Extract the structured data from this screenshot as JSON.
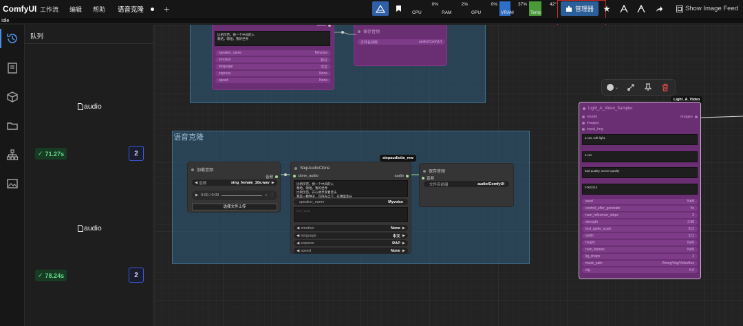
{
  "app": {
    "title": "ComfyUI",
    "status": "Idle"
  },
  "menu": [
    "工作流",
    "编辑",
    "帮助"
  ],
  "tab": {
    "label": "语音克隆"
  },
  "monitor": [
    {
      "label": "CPU",
      "pct": "0%"
    },
    {
      "label": "RAM",
      "pct": "2%"
    },
    {
      "label": "GPU",
      "pct": "0%"
    },
    {
      "label": "VRAM",
      "pct": "37%"
    },
    {
      "label": "Temp",
      "pct": "42°"
    }
  ],
  "toolbar": {
    "manager_label": "管理器",
    "feed_label": "Show Image Feed"
  },
  "queue": {
    "title": "队列",
    "items": [
      {
        "file": "audio",
        "time": "71.27s",
        "count": "2"
      },
      {
        "file": "audio",
        "time": "78.24s",
        "count": "2"
      }
    ]
  },
  "canvas": {
    "group_title": "语音克隆",
    "load_node": {
      "title": "加载音频",
      "out_label": "音频",
      "audio_label": "音频",
      "audio_value": "sing_female_10s.wav",
      "time": "0:00 / 0:00",
      "upload_label": "选择文件上传"
    },
    "clone_node": {
      "title": "StepAudioClone",
      "in_label": "clone_audio",
      "out_label": "audio",
      "text_lines": [
        "比例示范，换一个中间的入",
        "嗯哈，嗯哈，我的世界",
        "比例示范，开心地享受着音乐",
        "我是一颗种子，在阳光之下，在嘴里生长"
      ],
      "speaker_label": "speaker_name",
      "speaker_value": "Myvoice",
      "prompt_placeholder": "text_input",
      "widgets": [
        {
          "label": "emotion",
          "value": "None"
        },
        {
          "label": "language",
          "value": "中文"
        },
        {
          "label": "express",
          "value": "RAP"
        },
        {
          "label": "speed",
          "value": "None"
        }
      ],
      "badge": "stepaudiotts_mw"
    },
    "save_node": {
      "title": "保存音频",
      "in_label": "音频",
      "prefix_label": "文件名前缀",
      "prefix_value": "audio/ComfyUI"
    },
    "top_purple": {
      "text_lines": [
        "比例示范，换一个中间的入",
        "嗯哈，嗯哈，我的世界"
      ],
      "audio_out": "audio",
      "save_prefix_label": "文件名前缀",
      "save_prefix_value": "audio/ComfyUI",
      "widgets": [
        {
          "label": "speaker_name",
          "value": "Myvoice"
        },
        {
          "label": "emotion",
          "value": "默认"
        },
        {
          "label": "language",
          "value": "中文"
        },
        {
          "label": "express",
          "value": "None"
        },
        {
          "label": "speed",
          "value": "None"
        }
      ],
      "save_title": "保存音频"
    },
    "video_node": {
      "badge": "Light_A_Video",
      "title": "Light_A_Video_Sampler",
      "inputs": [
        "model",
        "images",
        "input_img"
      ],
      "out_label": "images",
      "prompts": [
        "a cat, soft light,",
        "a cat",
        "bad quality, worse quality",
        "FIXED1h"
      ],
      "widgets": [
        {
          "label": "seed",
          "value": "NaN"
        },
        {
          "label": "control_after_generate",
          "value": "fix"
        },
        {
          "label": "num_inference_steps",
          "value": "2"
        },
        {
          "label": "strength",
          "value": "2.98"
        },
        {
          "label": "text_guide_scale",
          "value": "512"
        },
        {
          "label": "width",
          "value": "512"
        },
        {
          "label": "height",
          "value": "NaN"
        },
        {
          "label": "num_frames",
          "value": "NaN"
        },
        {
          "label": "lig_shape",
          "value": "2"
        },
        {
          "label": "mask_path",
          "value": "ZhengYing/VideoBox"
        },
        {
          "label": "cfg",
          "value": "6.0"
        }
      ]
    }
  }
}
